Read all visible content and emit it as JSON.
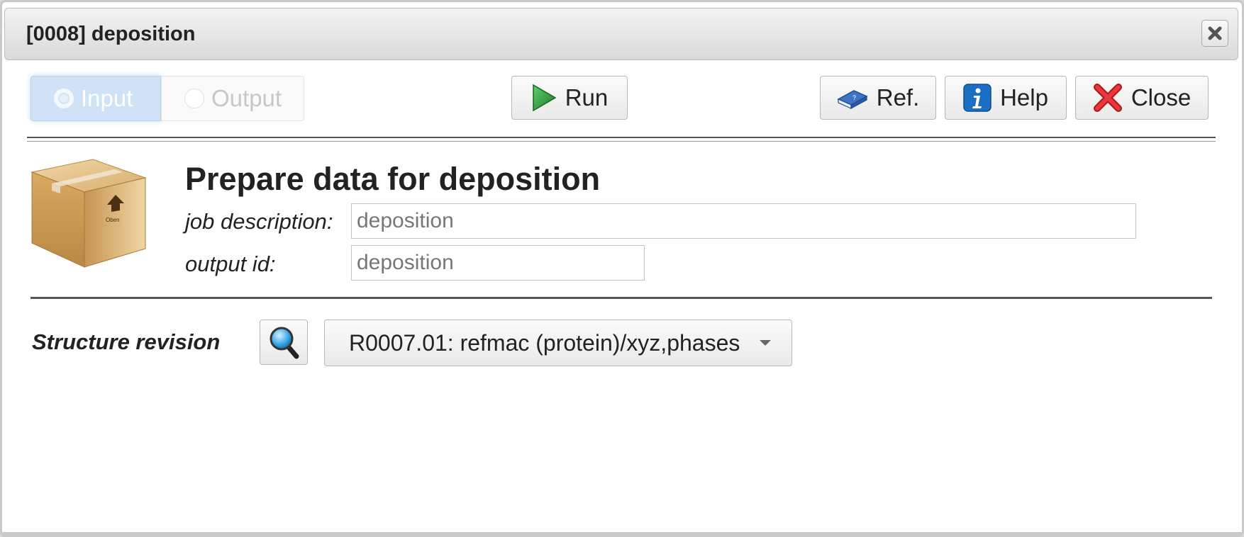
{
  "window": {
    "title": "[0008] deposition",
    "close_icon": "close-x-icon"
  },
  "toolbar": {
    "tabs": [
      {
        "label": "Input",
        "active": true
      },
      {
        "label": "Output",
        "active": false
      }
    ],
    "run_label": "Run",
    "ref_label": "Ref.",
    "help_label": "Help",
    "close_label": "Close"
  },
  "task": {
    "icon": "package-box-icon",
    "box_stamp": "Oben",
    "title": "Prepare data for deposition",
    "job_description": {
      "label": "job description:",
      "placeholder": "deposition",
      "value": ""
    },
    "output_id": {
      "label": "output id:",
      "placeholder": "deposition",
      "value": ""
    }
  },
  "inputs": {
    "structure_revision": {
      "label": "Structure revision",
      "selected": "R0007.01: refmac (protein)/xyz,phases"
    }
  },
  "colors": {
    "accent_active_tab": "#cfe2f6",
    "run_green": "#2e9a3a",
    "close_red": "#e0262b",
    "help_blue": "#1a6fc4"
  }
}
